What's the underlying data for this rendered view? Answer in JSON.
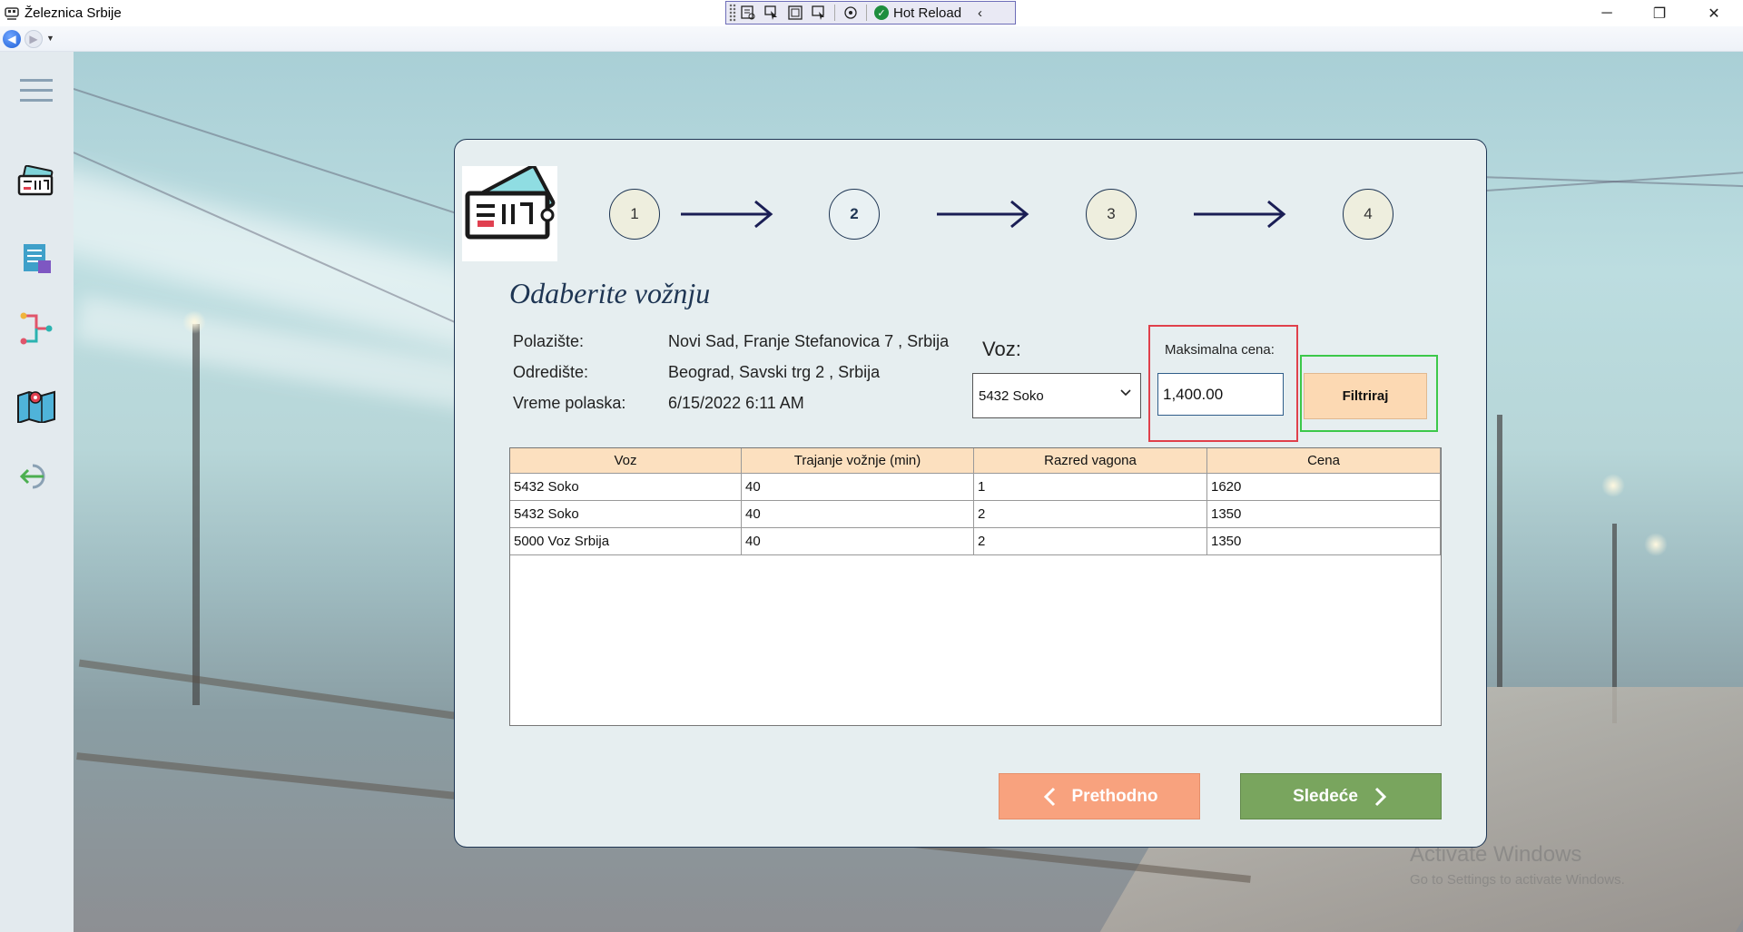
{
  "window": {
    "title": "Železnica Srbije",
    "hot_reload_label": "Hot Reload"
  },
  "page": {
    "heading": "Odaberite vožnju",
    "steps": [
      "1",
      "2",
      "3",
      "4"
    ],
    "active_step": 2
  },
  "info": {
    "polaziste_label": "Polazište:",
    "polaziste_value": "Novi Sad, Franje Stefanovica 7 , Srbija",
    "odrediste_label": "Odredište:",
    "odrediste_value": "Beograd, Savski trg 2 , Srbija",
    "vreme_label": "Vreme polaska:",
    "vreme_value": "6/15/2022 6:11 AM"
  },
  "filters": {
    "voz_label": "Voz:",
    "voz_selected": "5432 Soko",
    "max_price_label": "Maksimalna cena:",
    "max_price_value": "1,400.00",
    "filter_button": "Filtriraj"
  },
  "table": {
    "columns": [
      "Voz",
      "Trajanje vožnje (min)",
      "Razred vagona",
      "Cena"
    ],
    "rows": [
      [
        "5432 Soko",
        "40",
        "1",
        "1620"
      ],
      [
        "5432 Soko",
        "40",
        "2",
        "1350"
      ],
      [
        "5000 Voz Srbija",
        "40",
        "2",
        "1350"
      ]
    ]
  },
  "buttons": {
    "prev": "Prethodno",
    "next": "Sledeće"
  },
  "watermark": {
    "line1": "Activate Windows",
    "line2": "Go to Settings to activate Windows."
  },
  "colors": {
    "accent_dark": "#1e3553",
    "prev_button": "#f8a27e",
    "next_button": "#79a55e",
    "filter_button": "#fcd9b3",
    "table_header": "#fce0bf",
    "highlight_red": "#e0404b",
    "highlight_green": "#3cc84a"
  },
  "sidebar_icons": [
    "menu-icon",
    "ticket-icon",
    "list-icon",
    "route-icon",
    "map-icon",
    "logout-icon"
  ]
}
